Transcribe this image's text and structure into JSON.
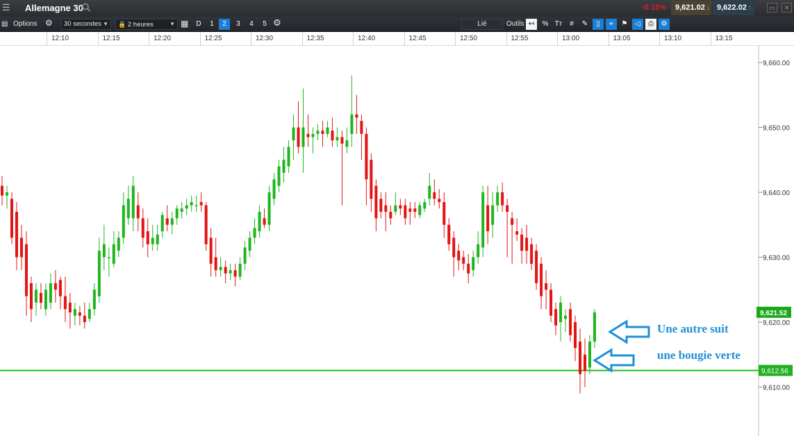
{
  "titlebar": {
    "title": "Allemagne 30",
    "change": "-0.15%",
    "sell_price": "9,621.02",
    "buy_price": "9,622.02"
  },
  "toolbar": {
    "options_label": "Options",
    "interval_value": "30 secondes",
    "range_value": "2 heures",
    "periods": [
      "D",
      "1",
      "2",
      "3",
      "4",
      "5"
    ],
    "active_period": "2",
    "link_label": "Lié",
    "tools_label": "Outils",
    "tool_icons": [
      "back-to-latest-icon",
      "percent-icon",
      "text-size-icon",
      "grid-icon",
      "drawing-pen-icon",
      "candlestick-icon",
      "crosshair-icon",
      "alert-icon",
      "label-icon",
      "print-icon",
      "settings-brush-icon"
    ]
  },
  "time_axis": [
    "12:10",
    "12:15",
    "12:20",
    "12:25",
    "12:30",
    "12:35",
    "12:40",
    "12:45",
    "12:50",
    "12:55",
    "13:00",
    "13:05",
    "13:10",
    "13:15"
  ],
  "price_axis": [
    "9,660.00",
    "9,650.00",
    "9,640.00",
    "9,630.00",
    "9,620.00",
    "9,610.00"
  ],
  "current_price_label": "9,621.52",
  "line_price_label": "9,612.56",
  "annotations": {
    "line1": "Une autre suit",
    "line2": "une bougie verte"
  },
  "colors": {
    "up": "#1fb51f",
    "down": "#e21414",
    "line": "#19c019",
    "arrow": "#1e8fd6"
  },
  "chart_data": {
    "type": "candlestick",
    "ylim": [
      9605,
      9664
    ],
    "horizontal_line": 9612.56,
    "current_price": 9621.52,
    "candles": [
      {
        "o": 9641.0,
        "h": 9642.5,
        "l": 9638.0,
        "c": 9639.5
      },
      {
        "o": 9639.5,
        "h": 9641.0,
        "l": 9637.5,
        "c": 9640.0
      },
      {
        "o": 9639.0,
        "h": 9640.0,
        "l": 9632.0,
        "c": 9633.0
      },
      {
        "o": 9637.0,
        "h": 9638.5,
        "l": 9628.0,
        "c": 9630.0
      },
      {
        "o": 9633.0,
        "h": 9635.0,
        "l": 9628.0,
        "c": 9630.0
      },
      {
        "o": 9632.0,
        "h": 9634.0,
        "l": 9621.0,
        "c": 9624.0
      },
      {
        "o": 9626.0,
        "h": 9627.0,
        "l": 9620.0,
        "c": 9622.0
      },
      {
        "o": 9623.0,
        "h": 9626.0,
        "l": 9621.0,
        "c": 9625.0
      },
      {
        "o": 9624.5,
        "h": 9626.0,
        "l": 9622.0,
        "c": 9623.0
      },
      {
        "o": 9622.0,
        "h": 9626.0,
        "l": 9621.0,
        "c": 9625.0
      },
      {
        "o": 9623.0,
        "h": 9627.5,
        "l": 9622.0,
        "c": 9626.0
      },
      {
        "o": 9626.0,
        "h": 9628.0,
        "l": 9623.0,
        "c": 9625.0
      },
      {
        "o": 9626.5,
        "h": 9627.0,
        "l": 9622.0,
        "c": 9624.0
      },
      {
        "o": 9624.0,
        "h": 9627.0,
        "l": 9620.0,
        "c": 9622.0
      },
      {
        "o": 9623.0,
        "h": 9624.5,
        "l": 9619.0,
        "c": 9621.5
      },
      {
        "o": 9621.0,
        "h": 9623.0,
        "l": 9619.5,
        "c": 9622.0
      },
      {
        "o": 9621.5,
        "h": 9622.5,
        "l": 9619.5,
        "c": 9621.0
      },
      {
        "o": 9621.0,
        "h": 9623.0,
        "l": 9619.0,
        "c": 9620.0
      },
      {
        "o": 9620.5,
        "h": 9623.0,
        "l": 9620.0,
        "c": 9622.0
      },
      {
        "o": 9622.0,
        "h": 9626.0,
        "l": 9621.0,
        "c": 9625.0
      },
      {
        "o": 9624.0,
        "h": 9633.0,
        "l": 9623.0,
        "c": 9631.0
      },
      {
        "o": 9630.0,
        "h": 9635.0,
        "l": 9628.0,
        "c": 9632.0
      },
      {
        "o": 9630.0,
        "h": 9631.5,
        "l": 9627.0,
        "c": 9630.0
      },
      {
        "o": 9629.0,
        "h": 9634.0,
        "l": 9628.5,
        "c": 9632.0
      },
      {
        "o": 9631.0,
        "h": 9634.0,
        "l": 9630.0,
        "c": 9633.0
      },
      {
        "o": 9633.0,
        "h": 9640.0,
        "l": 9632.0,
        "c": 9638.0
      },
      {
        "o": 9636.0,
        "h": 9641.0,
        "l": 9635.0,
        "c": 9639.0
      },
      {
        "o": 9636.0,
        "h": 9642.5,
        "l": 9634.0,
        "c": 9641.0
      },
      {
        "o": 9638.0,
        "h": 9640.0,
        "l": 9634.0,
        "c": 9636.0
      },
      {
        "o": 9636.0,
        "h": 9637.5,
        "l": 9631.5,
        "c": 9633.0
      },
      {
        "o": 9634.0,
        "h": 9636.0,
        "l": 9630.0,
        "c": 9632.0
      },
      {
        "o": 9632.0,
        "h": 9635.0,
        "l": 9631.0,
        "c": 9633.0
      },
      {
        "o": 9632.0,
        "h": 9635.0,
        "l": 9631.0,
        "c": 9633.5
      },
      {
        "o": 9634.0,
        "h": 9637.0,
        "l": 9633.0,
        "c": 9636.5
      },
      {
        "o": 9636.0,
        "h": 9638.0,
        "l": 9634.0,
        "c": 9635.0
      },
      {
        "o": 9635.0,
        "h": 9637.0,
        "l": 9633.5,
        "c": 9636.0
      },
      {
        "o": 9636.0,
        "h": 9638.0,
        "l": 9635.0,
        "c": 9637.5
      },
      {
        "o": 9637.0,
        "h": 9638.5,
        "l": 9636.0,
        "c": 9637.5
      },
      {
        "o": 9637.5,
        "h": 9639.0,
        "l": 9636.5,
        "c": 9638.0
      },
      {
        "o": 9638.0,
        "h": 9639.5,
        "l": 9637.0,
        "c": 9638.5
      },
      {
        "o": 9638.0,
        "h": 9639.5,
        "l": 9637.0,
        "c": 9638.0
      },
      {
        "o": 9638.5,
        "h": 9640.0,
        "l": 9637.0,
        "c": 9638.0
      },
      {
        "o": 9638.0,
        "h": 9638.5,
        "l": 9631.0,
        "c": 9632.0
      },
      {
        "o": 9633.0,
        "h": 9634.5,
        "l": 9627.0,
        "c": 9629.0
      },
      {
        "o": 9630.0,
        "h": 9633.0,
        "l": 9627.0,
        "c": 9628.0
      },
      {
        "o": 9628.0,
        "h": 9630.0,
        "l": 9627.0,
        "c": 9628.5
      },
      {
        "o": 9628.5,
        "h": 9629.5,
        "l": 9626.0,
        "c": 9627.5
      },
      {
        "o": 9627.5,
        "h": 9629.0,
        "l": 9626.5,
        "c": 9628.0
      },
      {
        "o": 9628.0,
        "h": 9629.0,
        "l": 9625.5,
        "c": 9627.0
      },
      {
        "o": 9627.0,
        "h": 9630.0,
        "l": 9626.5,
        "c": 9629.0
      },
      {
        "o": 9629.0,
        "h": 9632.5,
        "l": 9628.0,
        "c": 9631.5
      },
      {
        "o": 9631.0,
        "h": 9634.0,
        "l": 9630.0,
        "c": 9633.0
      },
      {
        "o": 9633.0,
        "h": 9636.0,
        "l": 9632.0,
        "c": 9634.5
      },
      {
        "o": 9634.0,
        "h": 9638.0,
        "l": 9633.0,
        "c": 9637.0
      },
      {
        "o": 9636.0,
        "h": 9637.5,
        "l": 9634.5,
        "c": 9635.0
      },
      {
        "o": 9635.0,
        "h": 9641.0,
        "l": 9634.0,
        "c": 9640.0
      },
      {
        "o": 9639.0,
        "h": 9643.0,
        "l": 9638.0,
        "c": 9642.0
      },
      {
        "o": 9641.0,
        "h": 9645.0,
        "l": 9640.0,
        "c": 9644.0
      },
      {
        "o": 9643.0,
        "h": 9647.0,
        "l": 9641.5,
        "c": 9645.0
      },
      {
        "o": 9644.0,
        "h": 9648.0,
        "l": 9643.0,
        "c": 9647.0
      },
      {
        "o": 9648.0,
        "h": 9652.0,
        "l": 9645.0,
        "c": 9650.0
      },
      {
        "o": 9650.0,
        "h": 9654.0,
        "l": 9646.0,
        "c": 9647.0
      },
      {
        "o": 9647.0,
        "h": 9656.0,
        "l": 9643.0,
        "c": 9650.0
      },
      {
        "o": 9649.0,
        "h": 9652.0,
        "l": 9647.0,
        "c": 9648.5
      },
      {
        "o": 9648.5,
        "h": 9650.0,
        "l": 9646.0,
        "c": 9649.0
      },
      {
        "o": 9649.0,
        "h": 9650.5,
        "l": 9648.0,
        "c": 9649.5
      },
      {
        "o": 9649.5,
        "h": 9651.0,
        "l": 9647.0,
        "c": 9649.0
      },
      {
        "o": 9649.0,
        "h": 9651.0,
        "l": 9648.5,
        "c": 9650.0
      },
      {
        "o": 9649.5,
        "h": 9651.5,
        "l": 9647.0,
        "c": 9648.0
      },
      {
        "o": 9648.0,
        "h": 9650.0,
        "l": 9647.0,
        "c": 9648.5
      },
      {
        "o": 9648.5,
        "h": 9649.5,
        "l": 9638.0,
        "c": 9647.5
      },
      {
        "o": 9647.0,
        "h": 9650.0,
        "l": 9646.0,
        "c": 9648.0
      },
      {
        "o": 9649.0,
        "h": 9658.0,
        "l": 9647.0,
        "c": 9652.0
      },
      {
        "o": 9652.0,
        "h": 9655.0,
        "l": 9649.0,
        "c": 9651.5
      },
      {
        "o": 9651.0,
        "h": 9652.0,
        "l": 9645.0,
        "c": 9649.0
      },
      {
        "o": 9649.0,
        "h": 9650.0,
        "l": 9638.0,
        "c": 9642.0
      },
      {
        "o": 9645.0,
        "h": 9646.0,
        "l": 9637.0,
        "c": 9639.0
      },
      {
        "o": 9641.0,
        "h": 9642.0,
        "l": 9634.0,
        "c": 9636.0
      },
      {
        "o": 9639.0,
        "h": 9640.0,
        "l": 9636.0,
        "c": 9637.0
      },
      {
        "o": 9638.0,
        "h": 9640.0,
        "l": 9634.0,
        "c": 9637.0
      },
      {
        "o": 9637.0,
        "h": 9638.0,
        "l": 9635.0,
        "c": 9636.0
      },
      {
        "o": 9637.0,
        "h": 9640.0,
        "l": 9636.5,
        "c": 9638.0
      },
      {
        "o": 9638.0,
        "h": 9639.0,
        "l": 9636.5,
        "c": 9637.5
      },
      {
        "o": 9638.0,
        "h": 9639.0,
        "l": 9635.0,
        "c": 9636.0
      },
      {
        "o": 9637.5,
        "h": 9638.5,
        "l": 9635.0,
        "c": 9637.0
      },
      {
        "o": 9637.5,
        "h": 9638.5,
        "l": 9636.0,
        "c": 9637.0
      },
      {
        "o": 9636.5,
        "h": 9638.5,
        "l": 9636.0,
        "c": 9638.0
      },
      {
        "o": 9637.5,
        "h": 9639.0,
        "l": 9637.0,
        "c": 9638.5
      },
      {
        "o": 9639.0,
        "h": 9643.0,
        "l": 9638.0,
        "c": 9641.0
      },
      {
        "o": 9640.0,
        "h": 9642.0,
        "l": 9638.0,
        "c": 9639.0
      },
      {
        "o": 9639.0,
        "h": 9640.5,
        "l": 9637.5,
        "c": 9638.5
      },
      {
        "o": 9638.5,
        "h": 9640.0,
        "l": 9633.0,
        "c": 9635.0
      },
      {
        "o": 9635.0,
        "h": 9636.0,
        "l": 9631.0,
        "c": 9632.0
      },
      {
        "o": 9633.0,
        "h": 9634.0,
        "l": 9627.0,
        "c": 9630.0
      },
      {
        "o": 9631.0,
        "h": 9632.0,
        "l": 9628.0,
        "c": 9629.5
      },
      {
        "o": 9630.0,
        "h": 9631.0,
        "l": 9628.0,
        "c": 9629.0
      },
      {
        "o": 9629.0,
        "h": 9630.5,
        "l": 9626.0,
        "c": 9627.5
      },
      {
        "o": 9628.0,
        "h": 9631.0,
        "l": 9627.0,
        "c": 9630.0
      },
      {
        "o": 9630.0,
        "h": 9634.0,
        "l": 9629.0,
        "c": 9632.0
      },
      {
        "o": 9631.5,
        "h": 9641.0,
        "l": 9630.0,
        "c": 9640.0
      },
      {
        "o": 9638.0,
        "h": 9641.0,
        "l": 9632.0,
        "c": 9634.0
      },
      {
        "o": 9635.0,
        "h": 9640.0,
        "l": 9633.0,
        "c": 9638.0
      },
      {
        "o": 9638.0,
        "h": 9641.0,
        "l": 9637.0,
        "c": 9640.0
      },
      {
        "o": 9640.0,
        "h": 9641.5,
        "l": 9637.0,
        "c": 9638.0
      },
      {
        "o": 9638.0,
        "h": 9639.0,
        "l": 9630.0,
        "c": 9637.0
      },
      {
        "o": 9636.0,
        "h": 9637.0,
        "l": 9629.0,
        "c": 9635.0
      },
      {
        "o": 9634.0,
        "h": 9636.0,
        "l": 9632.5,
        "c": 9633.5
      },
      {
        "o": 9633.5,
        "h": 9634.5,
        "l": 9629.0,
        "c": 9631.0
      },
      {
        "o": 9633.0,
        "h": 9635.0,
        "l": 9629.0,
        "c": 9631.0
      },
      {
        "o": 9632.0,
        "h": 9633.0,
        "l": 9628.0,
        "c": 9629.0
      },
      {
        "o": 9631.0,
        "h": 9632.0,
        "l": 9625.0,
        "c": 9626.0
      },
      {
        "o": 9629.0,
        "h": 9630.0,
        "l": 9622.0,
        "c": 9624.0
      },
      {
        "o": 9626.0,
        "h": 9628.0,
        "l": 9622.0,
        "c": 9625.0
      },
      {
        "o": 9625.0,
        "h": 9626.0,
        "l": 9620.0,
        "c": 9621.0
      },
      {
        "o": 9622.0,
        "h": 9623.0,
        "l": 9618.0,
        "c": 9619.5
      },
      {
        "o": 9620.0,
        "h": 9624.0,
        "l": 9617.0,
        "c": 9623.0
      },
      {
        "o": 9620.5,
        "h": 9622.0,
        "l": 9618.5,
        "c": 9621.0
      },
      {
        "o": 9622.0,
        "h": 9623.0,
        "l": 9617.0,
        "c": 9618.0
      },
      {
        "o": 9620.0,
        "h": 9621.0,
        "l": 9614.0,
        "c": 9616.0
      },
      {
        "o": 9617.0,
        "h": 9619.0,
        "l": 9609.0,
        "c": 9612.0
      },
      {
        "o": 9615.0,
        "h": 9617.5,
        "l": 9610.0,
        "c": 9612.5
      },
      {
        "o": 9613.0,
        "h": 9618.0,
        "l": 9612.0,
        "c": 9617.0
      },
      {
        "o": 9617.0,
        "h": 9622.0,
        "l": 9616.0,
        "c": 9621.5
      }
    ]
  }
}
